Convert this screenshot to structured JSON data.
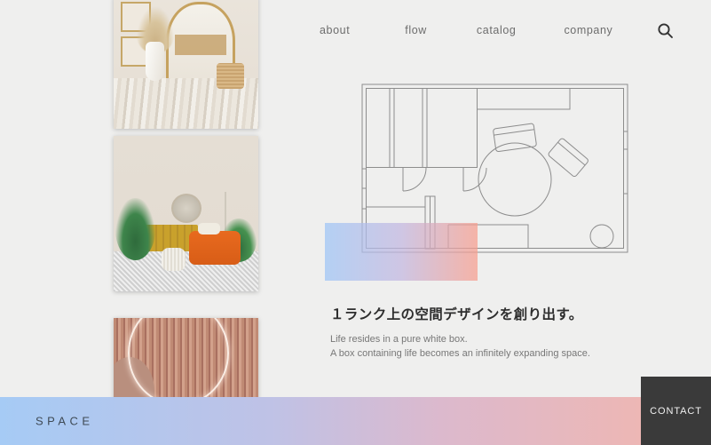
{
  "page": {
    "background_color": "#efefee",
    "accent_blue": "#a6cbf5",
    "accent_pink": "#f3b6ac",
    "dark": "#3a3a3a"
  },
  "nav": {
    "items": [
      {
        "label": "about"
      },
      {
        "label": "flow"
      },
      {
        "label": "catalog"
      },
      {
        "label": "company"
      }
    ],
    "search_icon": "search-icon"
  },
  "gallery": {
    "photos": [
      {
        "caption": "neutral interior with gold arched mirror, pampas grass and rattan stool"
      },
      {
        "caption": "mid-century living room with orange armchair, mustard sideboard and plants"
      },
      {
        "caption": "fluted terracotta wall with glowing neon circle"
      }
    ]
  },
  "plan": {
    "alt": "architectural floor plan with rooms, door swings, round table and chairs",
    "overlay": {
      "from_color": "#9dc4f6",
      "to_color": "#f79c8c"
    }
  },
  "copy": {
    "headline": "１ランク上の空間デザインを創り出す。",
    "line1": "Life resides in a pure white box.",
    "line2": "A box containing life becomes an infinitely expanding space."
  },
  "footer": {
    "brand": "SPACE",
    "contact_label": "CONTACT"
  }
}
